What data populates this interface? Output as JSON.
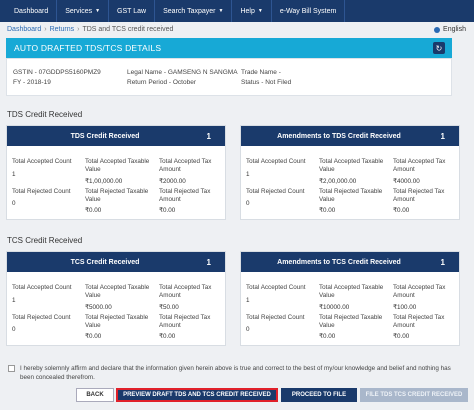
{
  "nav": {
    "items": [
      {
        "label": "Dashboard",
        "dropdown": false
      },
      {
        "label": "Services",
        "dropdown": true
      },
      {
        "label": "GST Law",
        "dropdown": false
      },
      {
        "label": "Search Taxpayer",
        "dropdown": true
      },
      {
        "label": "Help",
        "dropdown": true
      },
      {
        "label": "e-Way Bill System",
        "dropdown": false
      }
    ]
  },
  "breadcrumb": [
    "Dashboard",
    "Returns",
    "TDS and TCS credit received"
  ],
  "language": "English",
  "header": {
    "title": "AUTO DRAFTED TDS/TCS DETAILS"
  },
  "info": {
    "gstin": "GSTIN - 07GDDPS5160PMZ9",
    "fy": "FY - 2018-19",
    "legal_name": "Legal Name - GAMSENG N SANGMA",
    "return_period": "Return Period - October",
    "trade_name": "Trade Name -",
    "status": "Status - Not Filed"
  },
  "tds": {
    "section_title": "TDS Credit Received",
    "received": {
      "title": "TDS Credit Received",
      "count": "1",
      "accepted_count_label": "Total Accepted Count",
      "accepted_count": "1",
      "accepted_value_label": "Total Accepted Taxable Value",
      "accepted_value": "₹1,00,000.00",
      "accepted_tax_label": "Total Accepted Tax Amount",
      "accepted_tax": "₹2000.00",
      "rejected_count_label": "Total Rejected Count",
      "rejected_count": "0",
      "rejected_value_label": "Total Rejected Taxable Value",
      "rejected_value": "₹0.00",
      "rejected_tax_label": "Total Rejected Tax Amount",
      "rejected_tax": "₹0.00"
    },
    "amendments": {
      "title": "Amendments to TDS Credit Received",
      "count": "1",
      "accepted_count_label": "Total Accepted Count",
      "accepted_count": "1",
      "accepted_value_label": "Total Accepted Taxable Value",
      "accepted_value": "₹2,00,000.00",
      "accepted_tax_label": "Total Accepted Tax Amount",
      "accepted_tax": "₹4000.00",
      "rejected_count_label": "Total Rejected Count",
      "rejected_count": "0",
      "rejected_value_label": "Total Rejected Taxable Value",
      "rejected_value": "₹0.00",
      "rejected_tax_label": "Total Rejected Tax Amount",
      "rejected_tax": "₹0.00"
    }
  },
  "tcs": {
    "section_title": "TCS Credit Received",
    "received": {
      "title": "TCS Credit Received",
      "count": "1",
      "accepted_count_label": "Total Accepted Count",
      "accepted_count": "1",
      "accepted_value_label": "Total Accepted Taxable Value",
      "accepted_value": "₹5000.00",
      "accepted_tax_label": "Total Accepted Tax Amount",
      "accepted_tax": "₹50.00",
      "rejected_count_label": "Total Rejected Count",
      "rejected_count": "0",
      "rejected_value_label": "Total Rejected Taxable Value",
      "rejected_value": "₹0.00",
      "rejected_tax_label": "Total Rejected Tax Amount",
      "rejected_tax": "₹0.00"
    },
    "amendments": {
      "title": "Amendments to TCS Credit Received",
      "count": "1",
      "accepted_count_label": "Total Accepted Count",
      "accepted_count": "1",
      "accepted_value_label": "Total Accepted Taxable Value",
      "accepted_value": "₹10000.00",
      "accepted_tax_label": "Total Accepted Tax Amount",
      "accepted_tax": "₹100.00",
      "rejected_count_label": "Total Rejected Count",
      "rejected_count": "0",
      "rejected_value_label": "Total Rejected Taxable Value",
      "rejected_value": "₹0.00",
      "rejected_tax_label": "Total Rejected Tax Amount",
      "rejected_tax": "₹0.00"
    }
  },
  "declaration": "I hereby solemnly affirm and declare that the information given herein above is true and correct to the best of my/our knowledge and belief and nothing has been concealed therefrom.",
  "buttons": {
    "back": "BACK",
    "preview": "PREVIEW DRAFT TDS AND TCS CREDIT RECEIVED",
    "proceed": "PROCEED TO FILE",
    "file": "FILE TDS TCS CREDIT RECEIVED"
  },
  "colors": {
    "nav": "#1a3a6b",
    "header": "#17a9d6",
    "highlight": "#e0202a",
    "disabled": "#a9b7cb"
  }
}
